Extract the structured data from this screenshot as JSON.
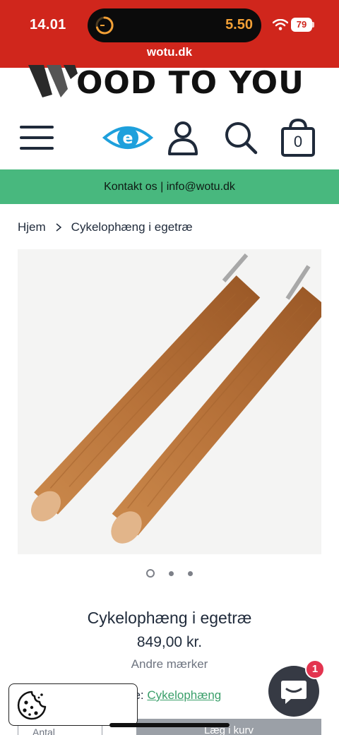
{
  "status_bar": {
    "time": "14.01",
    "timer": "5.50",
    "battery": "79",
    "url": "wotu.dk"
  },
  "logo": {
    "text": "OOD TO YOU"
  },
  "header": {
    "icons": [
      "menu-icon",
      "eye-logo-icon",
      "account-icon",
      "search-icon",
      "cart-icon"
    ],
    "cart_count": "0"
  },
  "contact_bar": {
    "text": "Kontakt os | info@wotu.dk"
  },
  "breadcrumb": {
    "home": "Hjem",
    "current": "Cykelophæng i egetræ"
  },
  "gallery": {
    "slide_count": 3,
    "active_slide": 1
  },
  "product": {
    "title": "Cykelophæng i egetræ",
    "price": "849,00 kr.",
    "brand": "Andre mærker",
    "type_prefix": "pe: ",
    "type_link": "Cykelophæng"
  },
  "purchase": {
    "quantity_label": "Antal",
    "add_button_label": "Læg i kurv"
  },
  "chat": {
    "badge": "1"
  },
  "colors": {
    "status_red": "#d0261c",
    "contact_green": "#48b87e",
    "link_green": "#3a9f6a",
    "eye_blue": "#1ea0dc",
    "chat_dark": "#363a44",
    "badge_red": "#e3344f"
  }
}
